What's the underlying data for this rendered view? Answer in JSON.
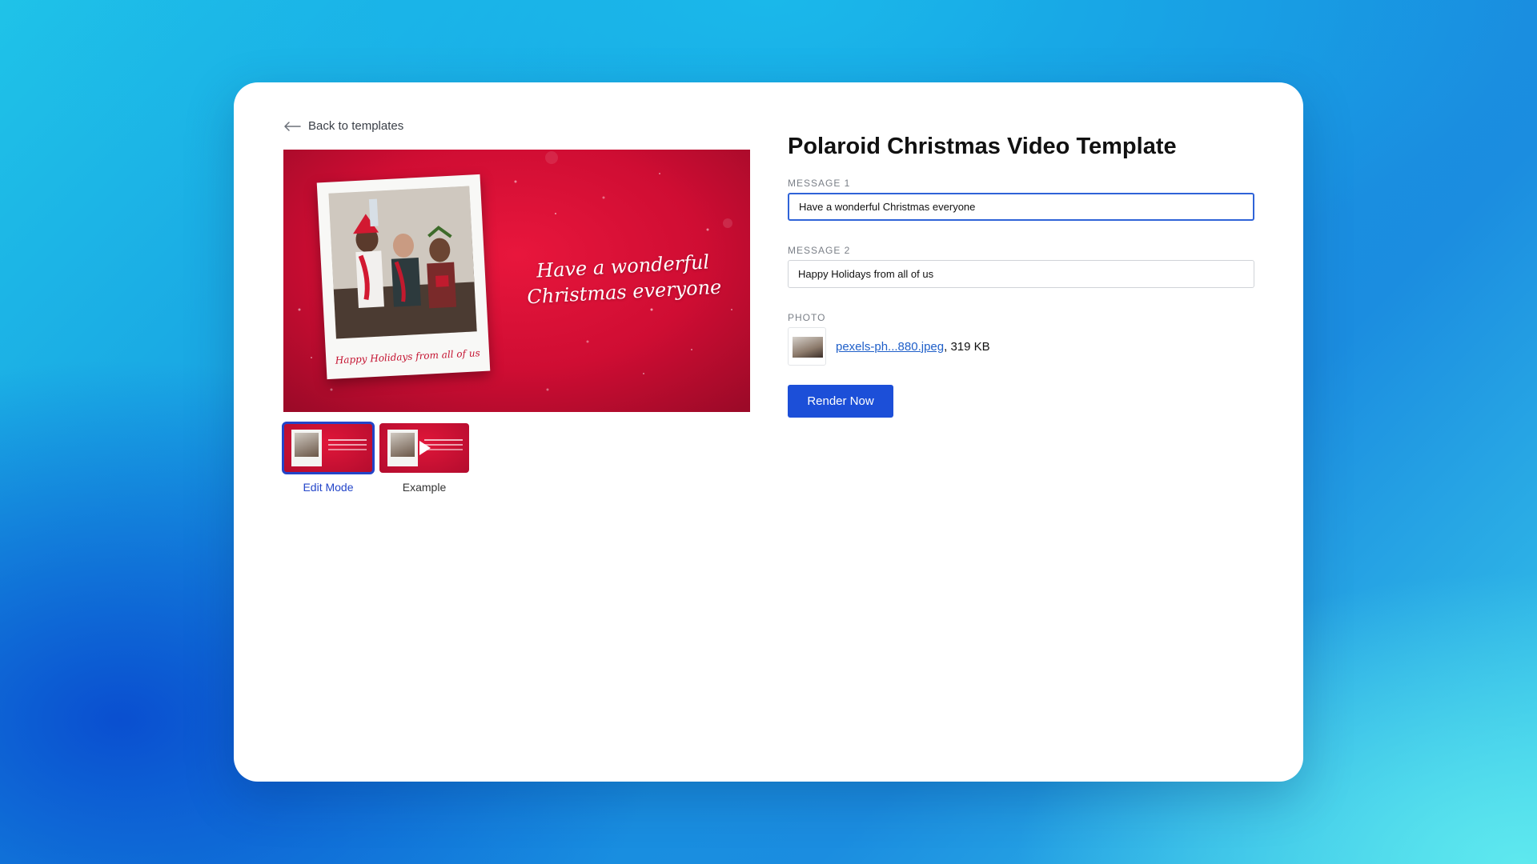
{
  "nav": {
    "back_label": "Back to templates"
  },
  "preview": {
    "message1_overlay": "Have a wonderful Christmas everyone",
    "message2_overlay": "Happy Holidays from all of us"
  },
  "thumbnails": [
    {
      "label": "Edit Mode",
      "active": true
    },
    {
      "label": "Example",
      "active": false
    }
  ],
  "form": {
    "title": "Polaroid Christmas Video Template",
    "message1": {
      "label": "MESSAGE 1",
      "value": "Have a wonderful Christmas everyone"
    },
    "message2": {
      "label": "MESSAGE 2",
      "value": "Happy Holidays from all of us"
    },
    "photo": {
      "label": "PHOTO",
      "file_name": "pexels-ph...880.jpeg",
      "file_size": ", 319 KB"
    },
    "render_label": "Render Now"
  },
  "colors": {
    "primary": "#1c4fd8",
    "link": "#1f5fc9",
    "template_red": "#d9102f"
  }
}
